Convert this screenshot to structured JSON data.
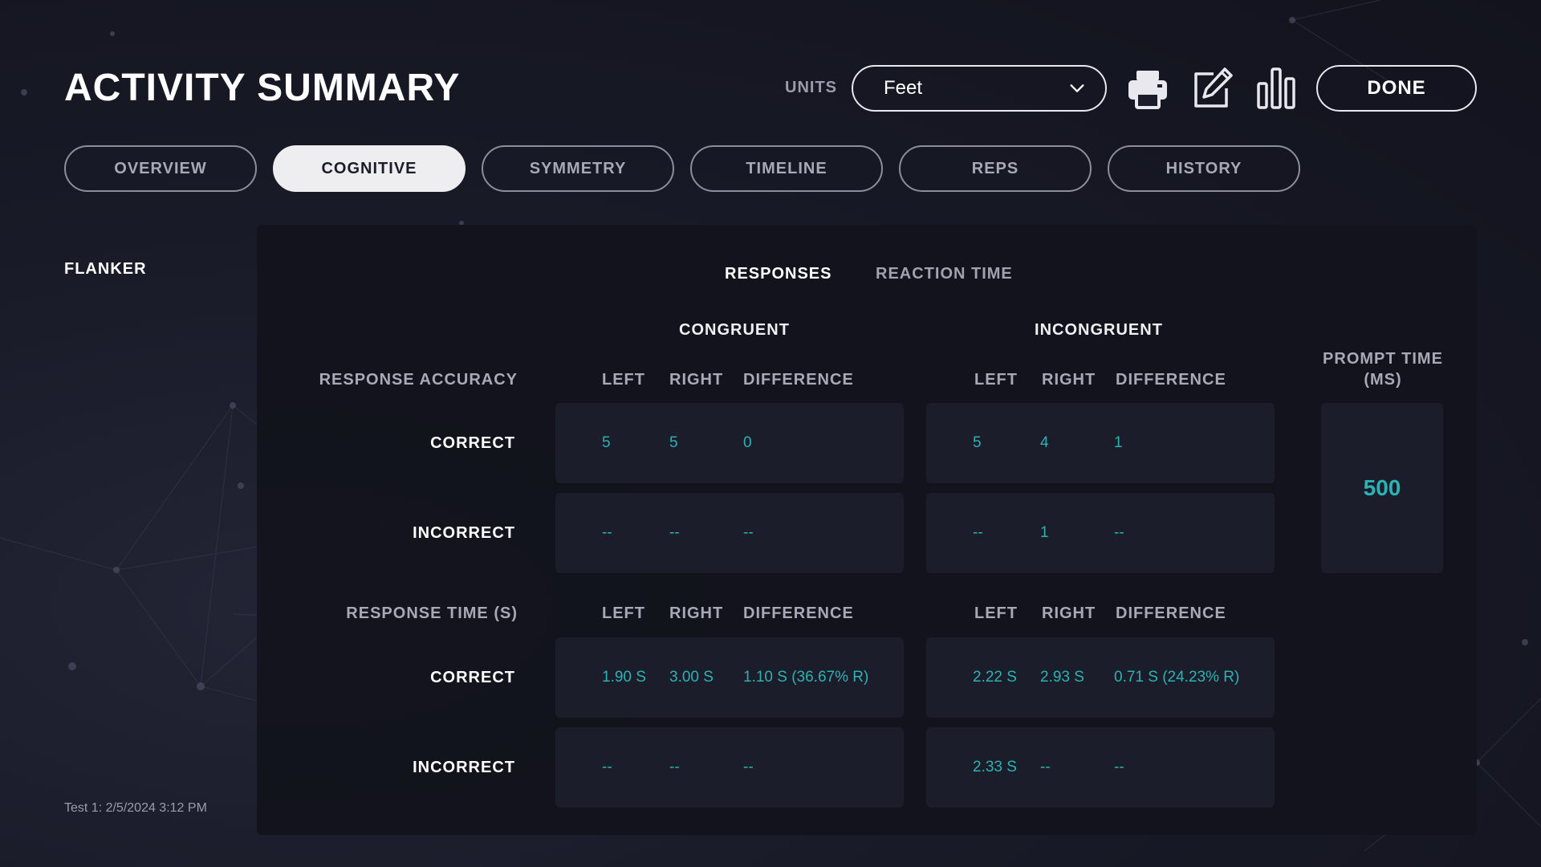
{
  "header": {
    "title": "ACTIVITY SUMMARY",
    "units_label": "UNITS",
    "units_value": "Feet",
    "done_label": "DONE",
    "icons": [
      "printer-icon",
      "edit-icon",
      "bar-chart-icon",
      "chevron-down-icon"
    ]
  },
  "tabs": [
    {
      "label": "OVERVIEW",
      "active": false
    },
    {
      "label": "COGNITIVE",
      "active": true
    },
    {
      "label": "SYMMETRY",
      "active": false
    },
    {
      "label": "TIMELINE",
      "active": false
    },
    {
      "label": "REPS",
      "active": false
    },
    {
      "label": "HISTORY",
      "active": false
    }
  ],
  "sidebar": {
    "title": "FLANKER",
    "test_label": "Test 1: 2/5/2024 3:12 PM"
  },
  "subtabs": {
    "responses": "RESPONSES",
    "reaction_time": "REACTION TIME",
    "active": "RESPONSES"
  },
  "groups": {
    "congruent": "CONGRUENT",
    "incongruent": "INCONGRUENT"
  },
  "columns": {
    "left": "LEFT",
    "right": "RIGHT",
    "difference": "DIFFERENCE"
  },
  "accuracy": {
    "label": "RESPONSE ACCURACY",
    "correct": {
      "label": "CORRECT",
      "congruent": {
        "left": "5",
        "right": "5",
        "difference": "0"
      },
      "incongruent": {
        "left": "5",
        "right": "4",
        "difference": "1"
      }
    },
    "incorrect": {
      "label": "INCORRECT",
      "congruent": {
        "left": "--",
        "right": "--",
        "difference": "--"
      },
      "incongruent": {
        "left": "--",
        "right": "1",
        "difference": "--"
      }
    }
  },
  "response_time": {
    "label": "RESPONSE TIME (S)",
    "correct": {
      "label": "CORRECT",
      "congruent": {
        "left": "1.90 S",
        "right": "3.00 S",
        "difference": "1.10 S (36.67% R)"
      },
      "incongruent": {
        "left": "2.22 S",
        "right": "2.93 S",
        "difference": "0.71 S (24.23% R)"
      }
    },
    "incorrect": {
      "label": "INCORRECT",
      "congruent": {
        "left": "--",
        "right": "--",
        "difference": "--"
      },
      "incongruent": {
        "left": "2.33 S",
        "right": "--",
        "difference": "--"
      }
    }
  },
  "prompt_time": {
    "label_line1": "PROMPT TIME",
    "label_line2": "(MS)",
    "value": "500"
  },
  "colors": {
    "accent_teal": "#2bb3b3",
    "background": "#181a27",
    "panel": "#12131c",
    "cell": "#1c1d2a"
  }
}
